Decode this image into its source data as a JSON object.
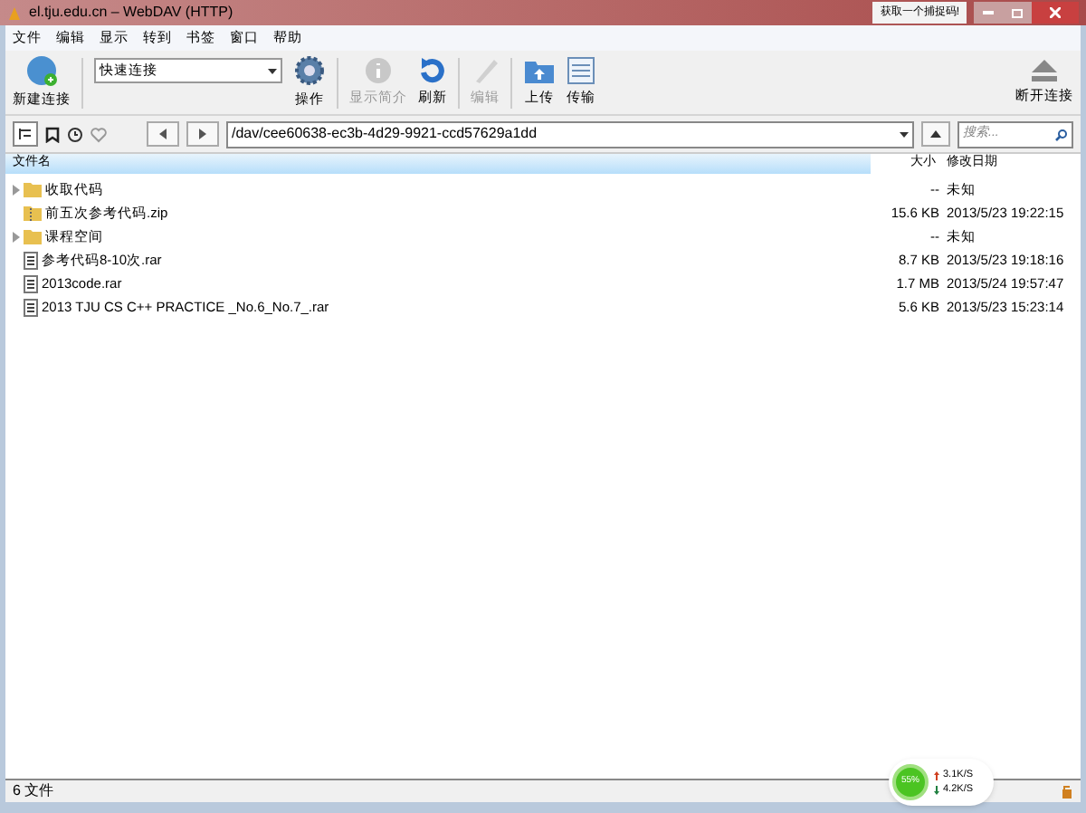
{
  "window": {
    "title": "el.tju.edu.cn – WebDAV (HTTP)",
    "badge": "获取一个捕捉码!"
  },
  "menu": [
    "文件",
    "编辑",
    "显示",
    "转到",
    "书签",
    "窗口",
    "帮助"
  ],
  "toolbar": {
    "new_connection": "新建连接",
    "quick_connect": "快速连接",
    "action": "操作",
    "info": "显示简介",
    "refresh": "刷新",
    "edit": "编辑",
    "upload": "上传",
    "transfers": "传输",
    "disconnect": "断开连接"
  },
  "nav": {
    "path": "/dav/cee60638-ec3b-4d29-9921-ccd57629a1dd",
    "search": {
      "placeholder": "搜索..."
    }
  },
  "table": {
    "columns": [
      "文件名",
      "大小",
      "修改日期"
    ],
    "rows": [
      {
        "kind": "folder",
        "name": "收取代码",
        "size": "--",
        "date": "未知"
      },
      {
        "kind": "zip",
        "name": "前五次参考代码.zip",
        "size": "15.6 KB",
        "date": "2013/5/23 19:22:15"
      },
      {
        "kind": "folder",
        "name": "课程空间",
        "size": "--",
        "date": "未知"
      },
      {
        "kind": "file",
        "name": "参考代码8-10次.rar",
        "size": "8.7 KB",
        "date": "2013/5/23 19:18:16"
      },
      {
        "kind": "file",
        "name": "2013code.rar",
        "size": "1.7 MB",
        "date": "2013/5/24 19:57:47"
      },
      {
        "kind": "file",
        "name": "2013 TJU CS C++ PRACTICE _No.6_No.7_.rar",
        "size": "5.6 KB",
        "date": "2013/5/23 15:23:14"
      }
    ]
  },
  "status_bar": {
    "text": "6 文件"
  },
  "speed": {
    "percent": "55%",
    "up": "3.1K/S",
    "down": "4.2K/S"
  }
}
